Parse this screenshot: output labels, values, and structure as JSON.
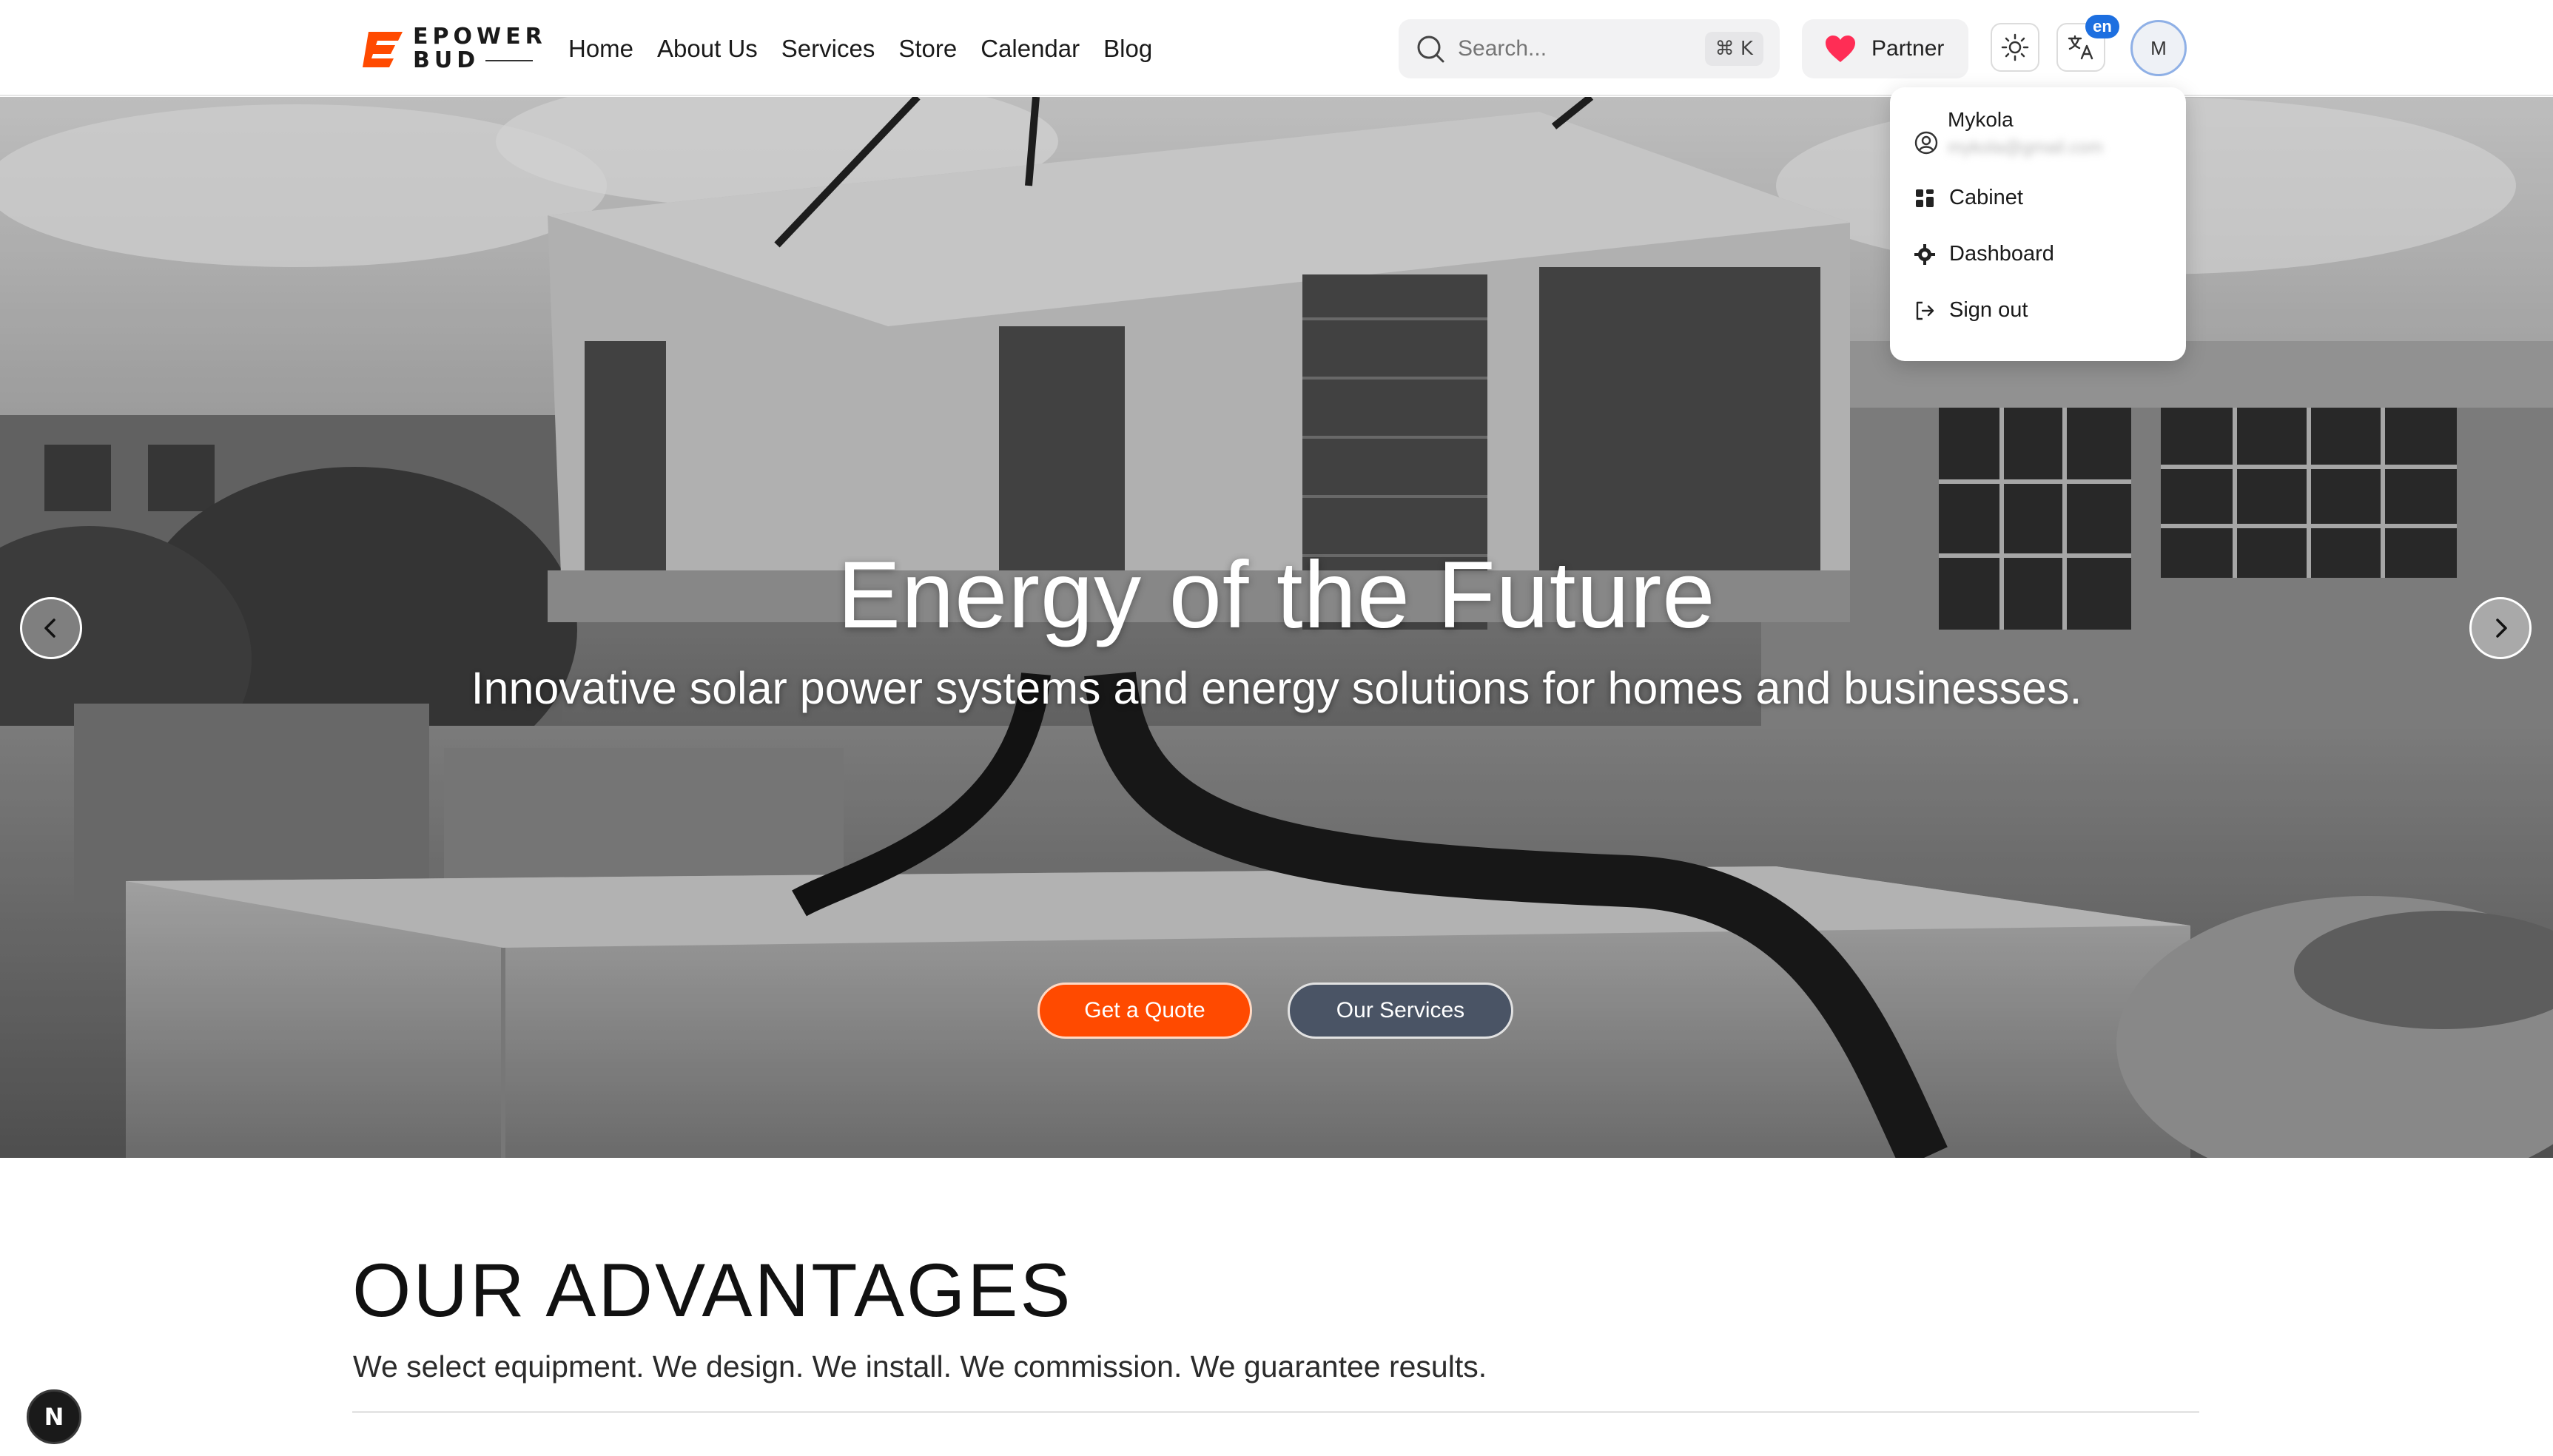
{
  "brand": {
    "line1": "EPOWER",
    "line2": "BUD",
    "accent": "#ff4a00"
  },
  "nav": [
    {
      "label": "Home"
    },
    {
      "label": "About Us"
    },
    {
      "label": "Services"
    },
    {
      "label": "Store"
    },
    {
      "label": "Calendar"
    },
    {
      "label": "Blog"
    }
  ],
  "search": {
    "placeholder": "Search...",
    "shortcut": "⌘ K",
    "icon": "search-icon"
  },
  "partner": {
    "label": "Partner",
    "icon": "heart-icon",
    "icon_color": "#ff2d55"
  },
  "theme_toggle": {
    "icon": "sun-icon"
  },
  "language": {
    "icon": "translate-icon",
    "badge": "en"
  },
  "avatar": {
    "initial": "M"
  },
  "user_menu": {
    "name": "Mykola",
    "email": "mykola@gmail.com",
    "items": [
      {
        "label": "Cabinet",
        "icon": "grid-icon"
      },
      {
        "label": "Dashboard",
        "icon": "gear-icon"
      },
      {
        "label": "Sign out",
        "icon": "sign-out-icon"
      }
    ]
  },
  "hero": {
    "title": "Energy of the Future",
    "subtitle": "Innovative solar power systems and energy solutions for homes and businesses.",
    "primary_cta": "Get a Quote",
    "secondary_cta": "Our Services",
    "slides_total": 2,
    "active_slide": 1
  },
  "advantages": {
    "title": "OUR ADVANTAGES",
    "subtitle": "We select equipment. We design. We install. We commission. We guarantee results."
  },
  "dev_badge": {
    "label": "N"
  }
}
